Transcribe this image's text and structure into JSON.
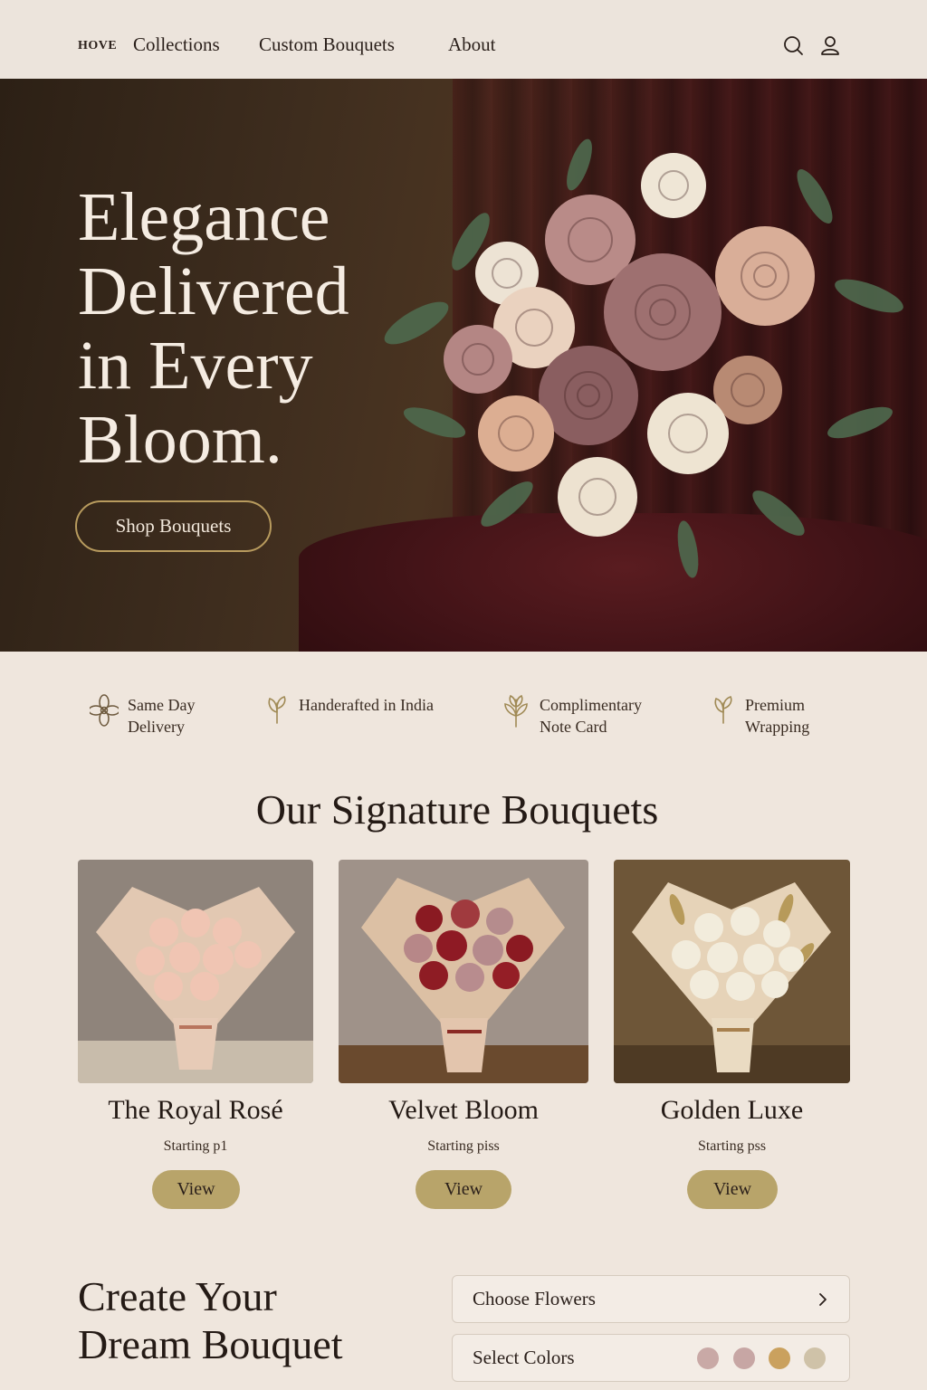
{
  "header": {
    "logo": "HOVE",
    "nav": [
      "Collections",
      "Custom Bouquets",
      "About"
    ],
    "icons": [
      "search-icon",
      "user-icon"
    ]
  },
  "hero": {
    "title_lines": [
      "Elegance",
      "Delivered",
      "in Every",
      "Bloom."
    ],
    "cta": "Shop Bouquets"
  },
  "features": [
    {
      "icon": "flower-icon",
      "lines": [
        "Same Day",
        "Delivery"
      ]
    },
    {
      "icon": "sprout-icon",
      "lines": [
        "Handerafted in India"
      ]
    },
    {
      "icon": "leaf-icon",
      "lines": [
        "Complimentary",
        "Note Card"
      ]
    },
    {
      "icon": "sprout-icon",
      "lines": [
        "Premium",
        "Wrapping"
      ]
    }
  ],
  "signature": {
    "title": "Our Signature Bouquets",
    "cards": [
      {
        "name": "The Royal Rosé",
        "price": "Starting p1",
        "button": "View"
      },
      {
        "name": "Velvet Bloom",
        "price": "Starting piss",
        "button": "View"
      },
      {
        "name": "Golden Luxe",
        "price": "Starting pss",
        "button": "View"
      }
    ]
  },
  "create": {
    "title_lines": [
      "Create Your",
      "Dream Bouquet"
    ],
    "options": [
      "Choose Flowers",
      "Select Colors"
    ],
    "color_swatches": [
      "#c9a9a6",
      "#c7a6a4",
      "#caa15e",
      "#cfc2a8"
    ]
  },
  "colors": {
    "accent_gold": "#b8a46a",
    "button_border": "#b89b5e",
    "background": "#efe6dd"
  }
}
